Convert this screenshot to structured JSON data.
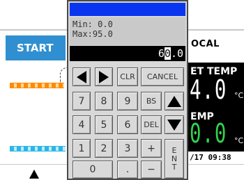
{
  "background": {
    "start_label": "START",
    "local_label": "OCAL",
    "set_temp_label": "ET TEMP",
    "set_temp_value": "4.0",
    "temp_unit": "°C",
    "temp_label": "EMP",
    "temp_value": "0.0",
    "datetime": "/17 09:38"
  },
  "keypad": {
    "min_text": "Min: 0.0",
    "max_text": "Max:95.0",
    "display_prefix": "6",
    "display_cursor": "0",
    "display_suffix": ".0",
    "keys": {
      "clr": "CLR",
      "cancel": "CANCEL",
      "k7": "7",
      "k8": "8",
      "k9": "9",
      "bs": "BS",
      "k4": "4",
      "k5": "5",
      "k6": "6",
      "del": "DEL",
      "k1": "1",
      "k2": "2",
      "k3": "3",
      "plus": "+",
      "k0": "0",
      "dot": ".",
      "minus": "−",
      "ent_e": "E",
      "ent_n": "N",
      "ent_t": "T"
    }
  },
  "colors": {
    "title_bar": "#0a35f0",
    "start_button": "#2f8fd0",
    "temp_value": "#34d24c"
  }
}
